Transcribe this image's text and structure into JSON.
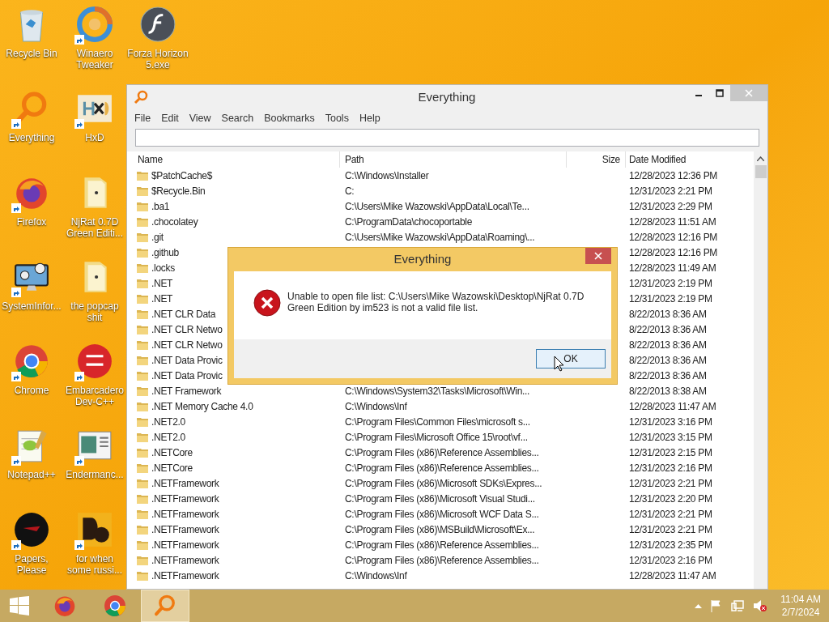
{
  "desktop_rows": [
    {
      "icons": [
        {
          "label": "Recycle Bin",
          "kind": "recycle",
          "shortcut": false
        },
        {
          "label": "Winaero Tweaker",
          "kind": "swirl",
          "shortcut": true
        },
        {
          "label": "Forza Horizon 5.exe",
          "kind": "flash",
          "shortcut": false
        }
      ]
    },
    {
      "icons": [
        {
          "label": "Everything",
          "kind": "everything",
          "shortcut": true
        },
        {
          "label": "HxD",
          "kind": "hxd",
          "shortcut": true
        }
      ]
    },
    {
      "icons": [
        {
          "label": "Firefox",
          "kind": "firefox",
          "shortcut": true
        },
        {
          "label": "NjRat 0.7D Green Editi...",
          "kind": "folder",
          "shortcut": false
        }
      ]
    },
    {
      "icons": [
        {
          "label": "SystemInfor...",
          "kind": "monitor",
          "shortcut": true
        },
        {
          "label": "the popcap shit",
          "kind": "folder",
          "shortcut": false
        }
      ]
    },
    {
      "icons": [
        {
          "label": "Chrome",
          "kind": "chrome",
          "shortcut": true
        },
        {
          "label": "Embarcadero Dev-C++",
          "kind": "devcpp",
          "shortcut": true
        }
      ]
    },
    {
      "icons": [
        {
          "label": "Notepad++",
          "kind": "notepad",
          "shortcut": true
        },
        {
          "label": "Endermanc...",
          "kind": "window",
          "shortcut": true
        }
      ]
    },
    {
      "icons": [
        {
          "label": "Papers, Please",
          "kind": "disc",
          "shortcut": true
        },
        {
          "label": "for when some russi...",
          "kind": "de",
          "shortcut": true
        }
      ]
    }
  ],
  "window": {
    "title": "Everything",
    "menu": [
      "File",
      "Edit",
      "View",
      "Search",
      "Bookmarks",
      "Tools",
      "Help"
    ],
    "columns": [
      "Name",
      "Path",
      "Size",
      "Date Modified"
    ],
    "rows": [
      {
        "name": "$PatchCache$",
        "path": "C:\\Windows\\Installer",
        "date": "12/28/2023 12:36 PM"
      },
      {
        "name": "$Recycle.Bin",
        "path": "C:",
        "date": "12/31/2023 2:21 PM"
      },
      {
        "name": ".ba1",
        "path": "C:\\Users\\Mike Wazowski\\AppData\\Local\\Te...",
        "date": "12/31/2023 2:29 PM"
      },
      {
        "name": ".chocolatey",
        "path": "C:\\ProgramData\\chocoportable",
        "date": "12/28/2023 11:51 AM"
      },
      {
        "name": ".git",
        "path": "C:\\Users\\Mike Wazowski\\AppData\\Roaming\\...",
        "date": "12/28/2023 12:16 PM"
      },
      {
        "name": ".github",
        "date": "12/28/2023 12:16 PM"
      },
      {
        "name": ".locks",
        "date": "12/28/2023 11:49 AM"
      },
      {
        "name": ".NET",
        "date": "12/31/2023 2:19 PM"
      },
      {
        "name": ".NET",
        "date": "12/31/2023 2:19 PM"
      },
      {
        "name": ".NET CLR Data",
        "date": "8/22/2013 8:36 AM"
      },
      {
        "name": ".NET CLR Netwo",
        "date": "8/22/2013 8:36 AM"
      },
      {
        "name": ".NET CLR Netwo",
        "date": "8/22/2013 8:36 AM"
      },
      {
        "name": ".NET Data Provic",
        "date": "8/22/2013 8:36 AM"
      },
      {
        "name": ".NET Data Provic",
        "date": "8/22/2013 8:36 AM"
      },
      {
        "name": ".NET Framework",
        "path": "C:\\Windows\\System32\\Tasks\\Microsoft\\Win...",
        "date": "8/22/2013 8:38 AM"
      },
      {
        "name": ".NET Memory Cache 4.0",
        "path": "C:\\Windows\\Inf",
        "date": "12/28/2023 11:47 AM"
      },
      {
        "name": ".NET2.0",
        "path": "C:\\Program Files\\Common Files\\microsoft s...",
        "date": "12/31/2023 3:16 PM"
      },
      {
        "name": ".NET2.0",
        "path": "C:\\Program Files\\Microsoft Office 15\\root\\vf...",
        "date": "12/31/2023 3:15 PM"
      },
      {
        "name": ".NETCore",
        "path": "C:\\Program Files (x86)\\Reference Assemblies...",
        "date": "12/31/2023 2:15 PM"
      },
      {
        "name": ".NETCore",
        "path": "C:\\Program Files (x86)\\Reference Assemblies...",
        "date": "12/31/2023 2:16 PM"
      },
      {
        "name": ".NETFramework",
        "path": "C:\\Program Files (x86)\\Microsoft SDKs\\Expres...",
        "date": "12/31/2023 2:21 PM"
      },
      {
        "name": ".NETFramework",
        "path": "C:\\Program Files (x86)\\Microsoft Visual Studi...",
        "date": "12/31/2023 2:20 PM"
      },
      {
        "name": ".NETFramework",
        "path": "C:\\Program Files (x86)\\Microsoft WCF Data S...",
        "date": "12/31/2023 2:21 PM"
      },
      {
        "name": ".NETFramework",
        "path": "C:\\Program Files (x86)\\MSBuild\\Microsoft\\Ex...",
        "date": "12/31/2023 2:21 PM"
      },
      {
        "name": ".NETFramework",
        "path": "C:\\Program Files (x86)\\Reference Assemblies...",
        "date": "12/31/2023 2:35 PM"
      },
      {
        "name": ".NETFramework",
        "path": "C:\\Program Files (x86)\\Reference Assemblies...",
        "date": "12/31/2023 2:16 PM"
      },
      {
        "name": ".NETFramework",
        "path": "C:\\Windows\\Inf",
        "date": "12/28/2023 11:47 AM"
      }
    ]
  },
  "dialog": {
    "title": "Everything",
    "message": "Unable to open file list: C:\\Users\\Mike Wazowski\\Desktop\\NjRat 0.7D Green Edition by im523 is not a valid file list.",
    "button": "OK"
  },
  "taskbar": {
    "apps": [
      {
        "kind": "firefox",
        "active": false
      },
      {
        "kind": "chrome",
        "active": false
      },
      {
        "kind": "everything",
        "active": true
      }
    ],
    "time": "11:04 AM",
    "date": "2/7/2024"
  }
}
